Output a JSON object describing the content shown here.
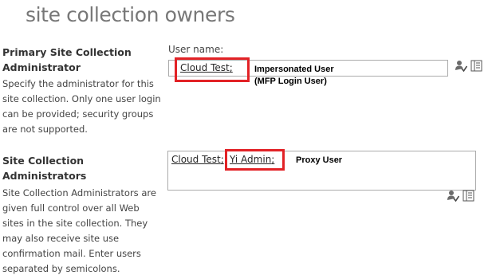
{
  "page": {
    "title": "site collection owners"
  },
  "primary": {
    "title_line1": "Primary Site Collection",
    "title_line2": "Administrator",
    "desc_lines": [
      "Specify the administrator for this",
      "site collection. Only one user login",
      "can be provided; security groups",
      "are not supported."
    ],
    "field_label": "User name:",
    "user": "Cloud Test",
    "separator": ";",
    "annotation_line1": "Impersonated User",
    "annotation_line2": "(MFP Login User)"
  },
  "admins": {
    "title_line1": "Site Collection",
    "title_line2": "Administrators",
    "desc_lines": [
      "Site Collection Administrators are",
      "given full control over all Web",
      "sites in the site collection. They",
      "may also receive site use",
      "confirmation mail. Enter users",
      "separated by semicolons."
    ],
    "users": [
      "Cloud Test",
      "Yi Admin"
    ],
    "separator": ";",
    "annotation": "Proxy User"
  },
  "icons": {
    "check_names": "check-names-icon",
    "browse": "address-book-icon"
  },
  "colors": {
    "highlight": "#e22226",
    "border": "#ababab"
  }
}
